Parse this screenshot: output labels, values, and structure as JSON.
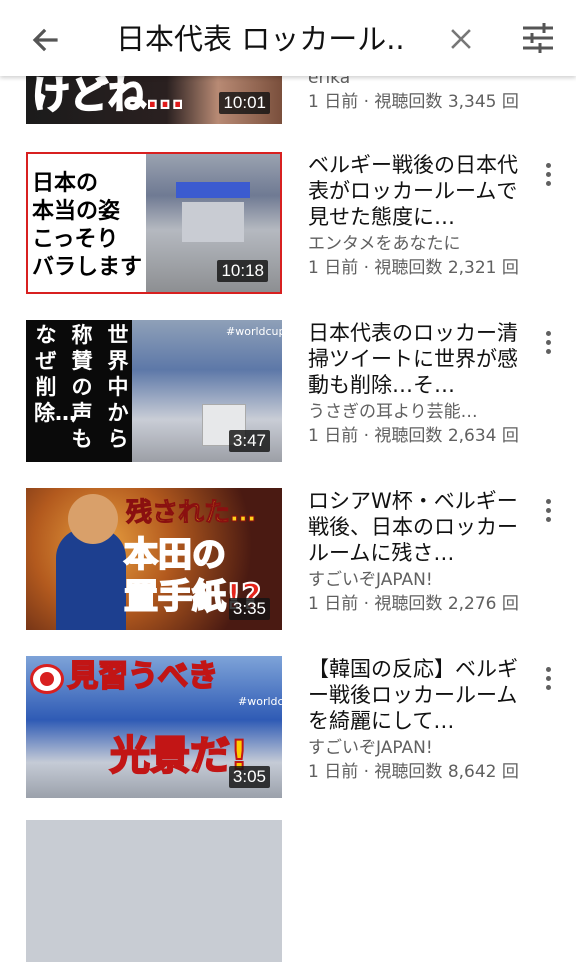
{
  "search": {
    "query": "日本代表 ロッカール..."
  },
  "icons": {
    "back": "back-arrow-icon",
    "clear": "close-icon",
    "filter": "filter-sliders-icon",
    "more": "more-vert-icon"
  },
  "videos": [
    {
      "title": "",
      "channel": "erika",
      "meta": "1 日前 · 視聴回数 3,345 回",
      "duration": "10:01",
      "thumb_text": "けどね…"
    },
    {
      "title": "ベルギー戦後の日本代表がロッカールームで見せた態度に…",
      "channel": "エンタメをあなたに",
      "meta": "1 日前 · 視聴回数 2,321 回",
      "duration": "10:18",
      "thumb_lines": [
        "日本の",
        "本当の姿",
        "こっそり",
        "バラします"
      ]
    },
    {
      "title": "日本代表のロッカー清掃ツイートに世界が感動も削除…そ…",
      "channel": "うさぎの耳より芸能…",
      "meta": "1 日前 · 視聴回数 2,634 回",
      "duration": "3:47",
      "thumb_cols": [
        "世界中から",
        "称賛の声も",
        "なぜ削除…"
      ],
      "thumb_tag": "#worldcup"
    },
    {
      "title": "ロシアW杯・ベルギー戦後、日本のロッカールームに残さ…",
      "channel": "すごいぞJAPAN!",
      "meta": "1 日前 · 視聴回数 2,276 回",
      "duration": "3:35",
      "thumb_lines": [
        "残された…",
        "本田の",
        "置手紙!?"
      ]
    },
    {
      "title": "【韓国の反応】ベルギー戦後ロッカールームを綺麗にして…",
      "channel": "すごいぞJAPAN!",
      "meta": "1 日前 · 視聴回数 8,642 回",
      "duration": "3:05",
      "thumb_lines": [
        "見習うべき",
        "光景だ!"
      ],
      "thumb_tag": "#worldcup"
    }
  ]
}
